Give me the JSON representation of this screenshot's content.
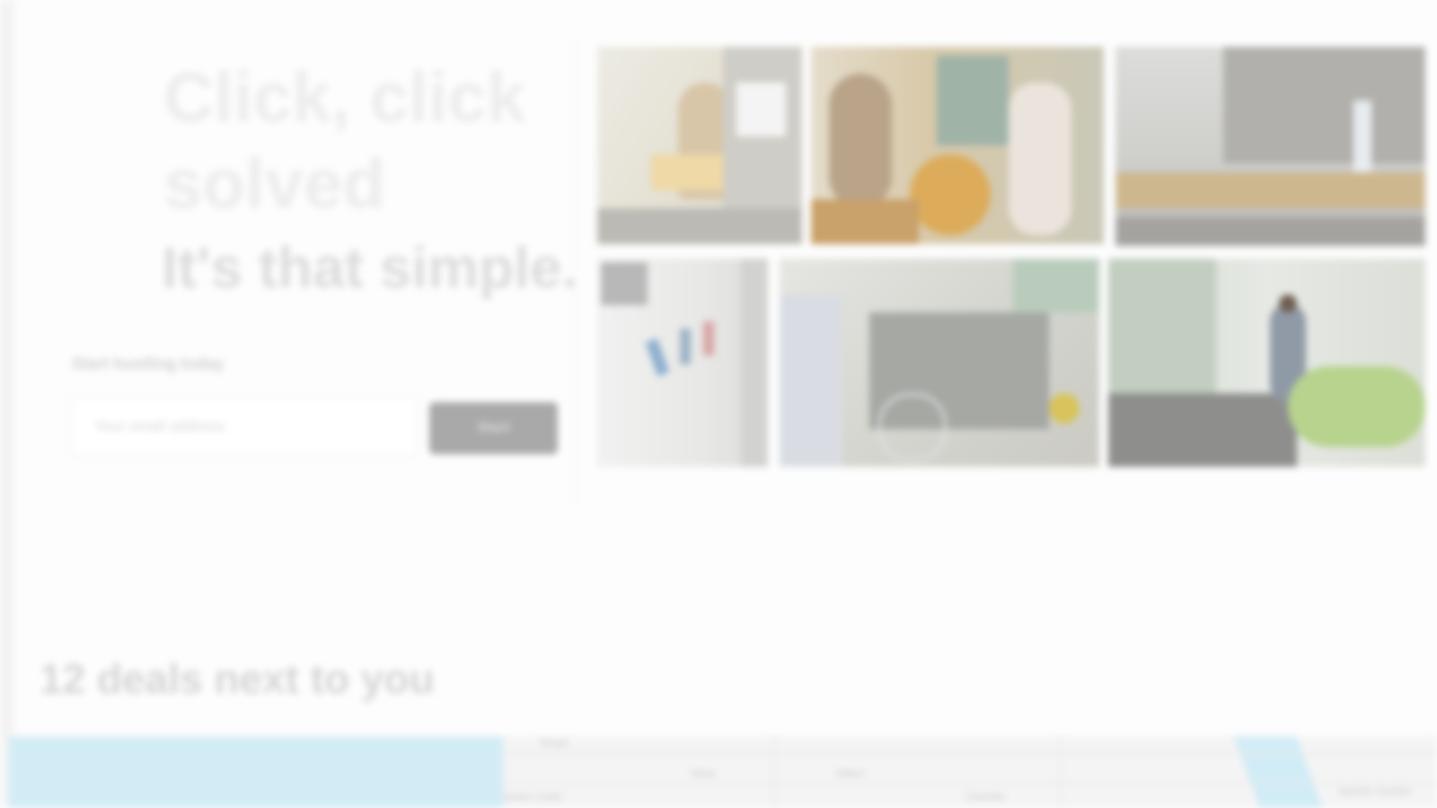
{
  "hero": {
    "title": "Click, click solved",
    "subtitle": "It's that simple.",
    "signup_label": "Start hustling today",
    "email_placeholder": "Your email address",
    "start_button_label": "Start"
  },
  "photos": [
    {
      "name": "photo-person-reading"
    },
    {
      "name": "photo-market-crowd"
    },
    {
      "name": "photo-city-street"
    },
    {
      "name": "photo-bright-interior"
    },
    {
      "name": "photo-market-stall"
    },
    {
      "name": "photo-greenhouse-worker"
    }
  ],
  "deals": {
    "heading": "12 deals next to you"
  },
  "map": {
    "labels": [
      "Tempe",
      "Mesa",
      "Gilbert",
      "Chandler",
      "Queen Creek",
      "Apache Junction"
    ]
  },
  "colors": {
    "water": "#d2ecf6",
    "button": "#a9a9a9",
    "background": "#fdfdfd"
  }
}
